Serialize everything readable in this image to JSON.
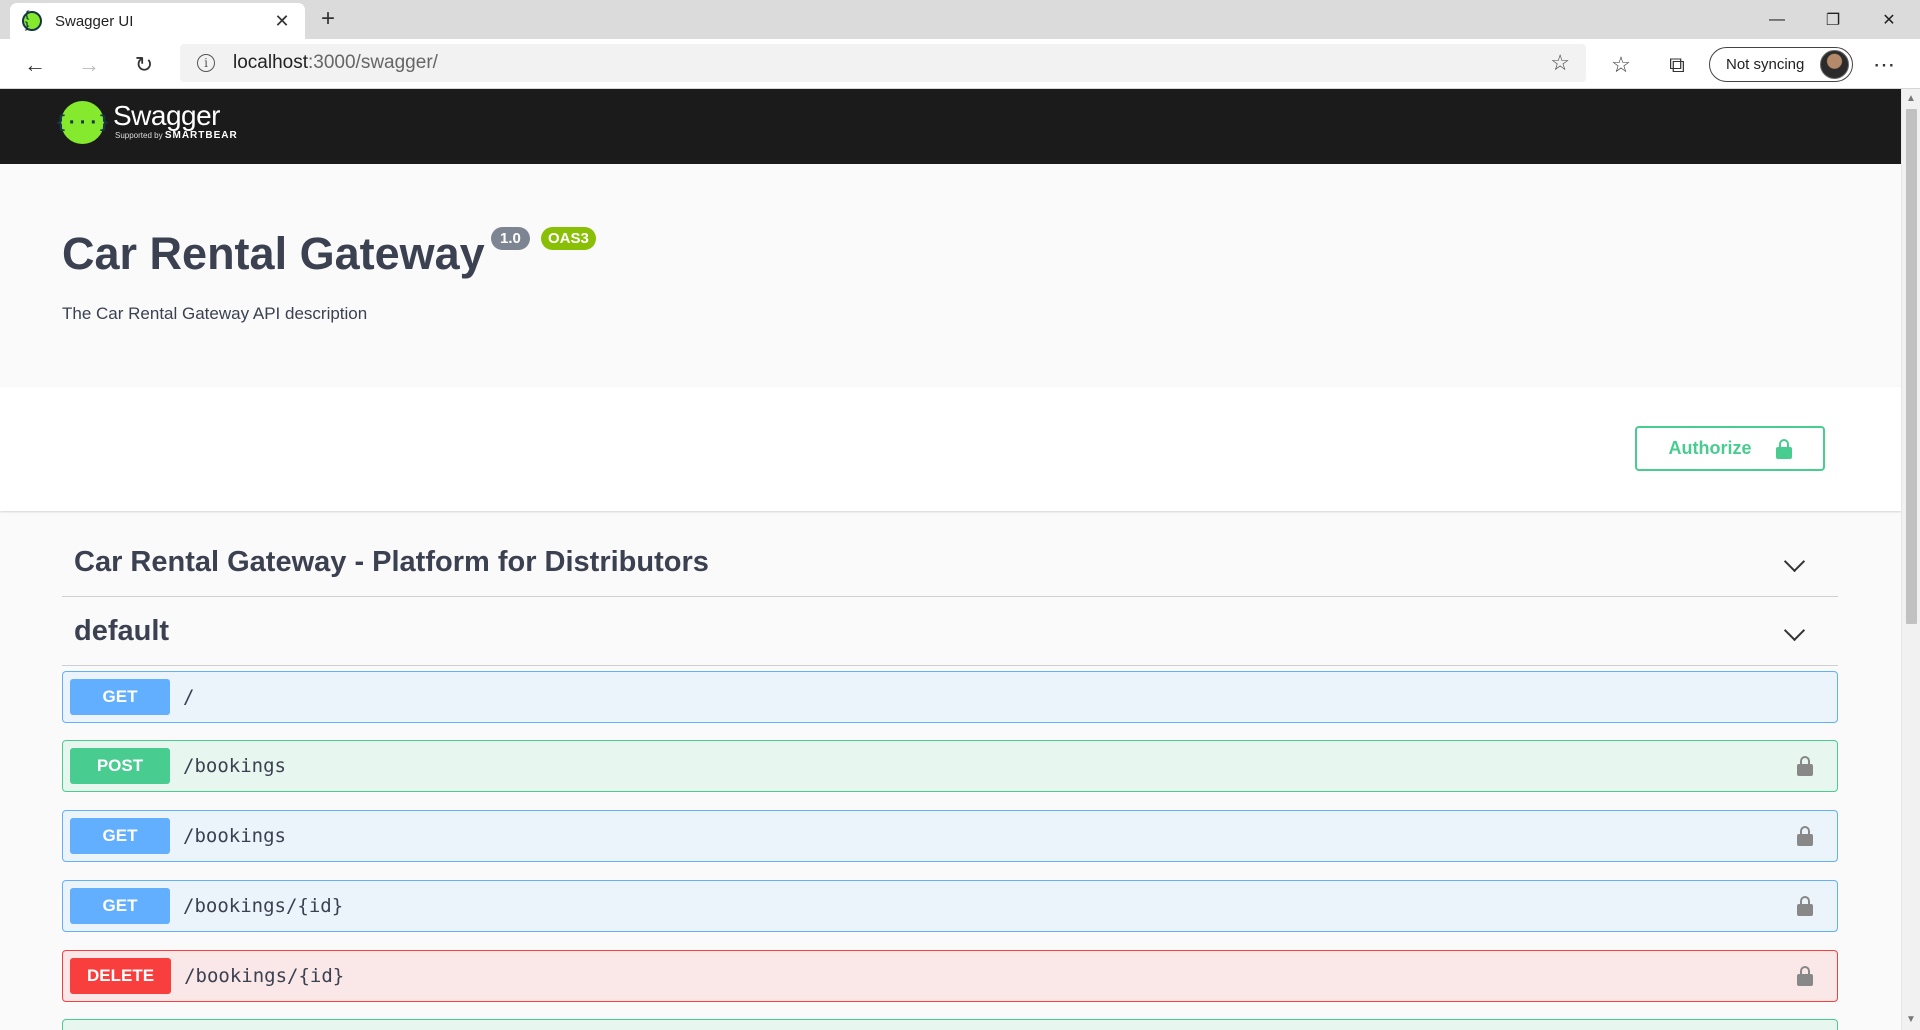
{
  "browser": {
    "tab_title": "Swagger UI",
    "tab_favicon": "{ }",
    "url_host": "localhost",
    "url_path": ":3000/swagger/",
    "sync_label": "Not syncing"
  },
  "swagger": {
    "logo_mark": "{···}",
    "logo_name": "Swagger",
    "logo_sub_prefix": "Supported by",
    "logo_sub_brand": "SMARTBEAR"
  },
  "info": {
    "title": "Car Rental Gateway",
    "version": "1.0",
    "oas": "OAS3",
    "description": "The Car Rental Gateway API description"
  },
  "auth": {
    "label": "Authorize"
  },
  "tags": [
    {
      "name": "Car Rental Gateway - Platform for Distributors"
    },
    {
      "name": "default"
    }
  ],
  "operations": [
    {
      "method": "GET",
      "path": "/"
    },
    {
      "method": "POST",
      "path": "/bookings"
    },
    {
      "method": "GET",
      "path": "/bookings"
    },
    {
      "method": "GET",
      "path": "/bookings/{id}"
    },
    {
      "method": "DELETE",
      "path": "/bookings/{id}"
    }
  ],
  "colors": {
    "get": "#61affe",
    "post": "#49cc90",
    "delete": "#f93e3e",
    "swagger_green": "#85ea2d",
    "topbar": "#1b1b1b"
  },
  "icons": [
    "back-icon",
    "forward-icon",
    "refresh-icon",
    "info-icon",
    "star-icon",
    "favorites-icon",
    "collections-icon",
    "more-icon",
    "lock-icon",
    "chevron-down-icon"
  ]
}
